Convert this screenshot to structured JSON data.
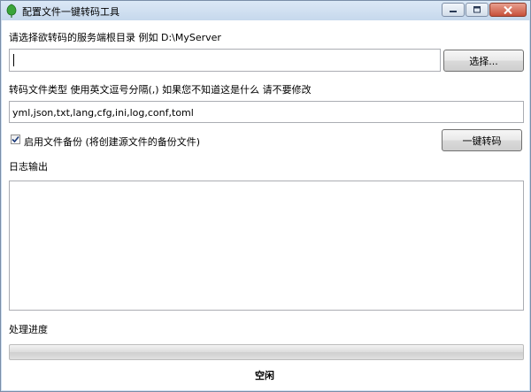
{
  "window": {
    "title": "配置文件一键转码工具",
    "controls": {
      "minimize": "minimize",
      "maximize": "maximize",
      "close": "close"
    }
  },
  "server_dir": {
    "label": "请选择欲转码的服务端根目录 例如 D:\\MyServer",
    "value": "",
    "browse_label": "选择..."
  },
  "file_types": {
    "label": "转码文件类型 使用英文逗号分隔(,) 如果您不知道这是什么 请不要修改",
    "value": "yml,json,txt,lang,cfg,ini,log,conf,toml"
  },
  "backup": {
    "checked": true,
    "label": "启用文件备份 (将创建源文件的备份文件)"
  },
  "convert_button": {
    "label": "一键转码"
  },
  "log": {
    "label": "日志输出",
    "content": ""
  },
  "progress": {
    "label": "处理进度",
    "value": 0
  },
  "status": {
    "text": "空闲"
  },
  "colors": {
    "accent": "#37b12a",
    "close": "#c7503a"
  }
}
